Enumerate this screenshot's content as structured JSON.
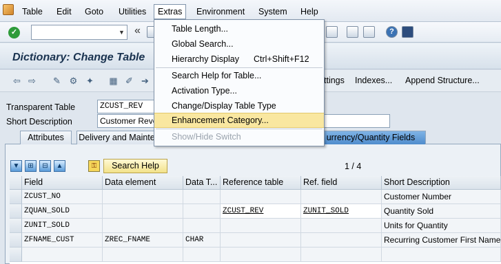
{
  "menubar": {
    "items": [
      {
        "label": "Table"
      },
      {
        "label": "Edit"
      },
      {
        "label": "Goto"
      },
      {
        "label": "Utilities"
      },
      {
        "label": "Extras"
      },
      {
        "label": "Environment"
      },
      {
        "label": "System"
      },
      {
        "label": "Help"
      }
    ]
  },
  "toolbar": {
    "command_field": ""
  },
  "title": "Dictionary: Change Table",
  "app_toolbar": {
    "settings_label": "ttings",
    "indexes_label": "Indexes...",
    "append_label": "Append Structure..."
  },
  "fields": {
    "transparent_table_label": "Transparent Table",
    "transparent_table_value": "ZCUST_REV",
    "short_description_label": "Short Description",
    "short_description_value": "Customer Reve"
  },
  "tabs": [
    {
      "label": "Attributes"
    },
    {
      "label": "Delivery and Mainte"
    },
    {
      "label": "urrency/Quantity Fields"
    }
  ],
  "search_help_label": "Search Help",
  "pager": "1  /  4",
  "table": {
    "columns": [
      "Field",
      "Data element",
      "Data T...",
      "Reference table",
      "Ref. field",
      "Short Description"
    ],
    "rows": [
      {
        "field": "ZCUST_NO",
        "data_element": "",
        "data_type": "",
        "ref_table": "",
        "ref_field": "",
        "desc": "Customer Number"
      },
      {
        "field": "ZQUAN_SOLD",
        "data_element": "",
        "data_type": "",
        "ref_table": "ZCUST_REV",
        "ref_field": "ZUNIT_SOLD",
        "desc": "Quantity Sold"
      },
      {
        "field": "ZUNIT_SOLD",
        "data_element": "",
        "data_type": "",
        "ref_table": "",
        "ref_field": "",
        "desc": "Units for Quantity"
      },
      {
        "field": "ZFNAME_CUST",
        "data_element": "ZREC_FNAME",
        "data_type": "CHAR",
        "ref_table": "",
        "ref_field": "",
        "desc": "Recurring Customer First Name"
      }
    ]
  },
  "extras_menu": {
    "items": [
      {
        "label": "Table Length...",
        "shortcut": ""
      },
      {
        "label": "Global Search...",
        "shortcut": ""
      },
      {
        "label": "Hierarchy Display",
        "shortcut": "Ctrl+Shift+F12"
      },
      {
        "label": "Search Help for Table...",
        "shortcut": ""
      },
      {
        "label": "Activation Type...",
        "shortcut": ""
      },
      {
        "label": "Change/Display Table Type",
        "shortcut": ""
      },
      {
        "label": "Enhancement Category...",
        "shortcut": ""
      },
      {
        "label": "Show/Hide Switch",
        "shortcut": ""
      }
    ]
  }
}
